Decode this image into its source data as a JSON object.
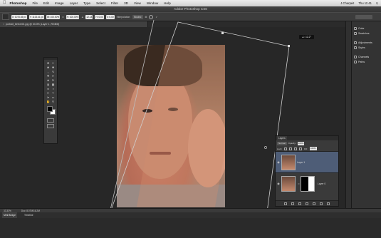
{
  "menubar": {
    "apple": "",
    "items": [
      "Photoshop",
      "File",
      "Edit",
      "Image",
      "Layer",
      "Type",
      "Select",
      "Filter",
      "3D",
      "View",
      "Window",
      "Help"
    ],
    "user": "J.Charpeit",
    "clock": "Thu 11:41"
  },
  "window": {
    "title": "Adobe Photoshop CS6"
  },
  "options": {
    "x": "X: 1070.65 px",
    "y": "Y: 1102.41 px",
    "w": "W: 100.00%",
    "h": "H: 100.00%",
    "angle": "12.18",
    "hskew": "H: 0.00",
    "vskew": "V: 0.00",
    "interp_label": "Interpolation:",
    "interp_value": "Bicubic"
  },
  "document": {
    "tab": "portrait_before01.jpg @ 33.3% (Layer 1, RGB/8)",
    "tooltip": "∠: 12.2°",
    "zoom": "33.33%",
    "doc_size": "Doc: 8.07M/16.2M"
  },
  "layers": {
    "tab": "Layers",
    "blend": "Normal",
    "opacity_label": "Opacity:",
    "opacity": "100%",
    "lock_label": "Lock:",
    "fill_label": "Fill:",
    "fill": "100%",
    "rows": [
      {
        "name": "Layer 1"
      },
      {
        "name": "Layer 0"
      }
    ]
  },
  "panels": {
    "items": [
      "Color",
      "Swatches",
      "Adjustments",
      "Styles",
      "Channels",
      "Paths"
    ]
  },
  "bottom": {
    "tabs": [
      "Mini Bridge",
      "Timeline"
    ]
  },
  "colors": {
    "selected_layer": "#4e5d77",
    "foreground": "#000000",
    "background": "#ffffff"
  }
}
